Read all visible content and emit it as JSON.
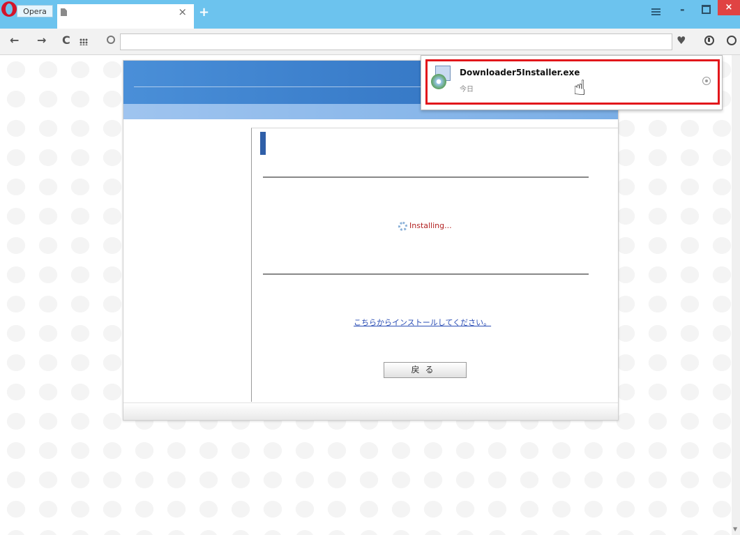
{
  "browser": {
    "app_label": "Opera",
    "tab_close_glyph": "×",
    "new_tab_glyph": "+",
    "window_controls": {
      "minimize": "-",
      "close": "×"
    },
    "toolbar": {
      "back": "←",
      "forward": "→",
      "reload": "C",
      "heart": "♥"
    },
    "address": ""
  },
  "download_popup": {
    "file_name": "Downloader5Installer.exe",
    "date_label": "今日",
    "icon": "installer-file-icon"
  },
  "page": {
    "status_text": "Installing...",
    "install_link": "こちらからインストールしてください。",
    "back_button": "戻る"
  },
  "colors": {
    "titlebar": "#6cc3ee",
    "highlight": "#e2161b",
    "header_blue": "#3a7dca",
    "link": "#2a4db5",
    "status": "#b22222"
  }
}
